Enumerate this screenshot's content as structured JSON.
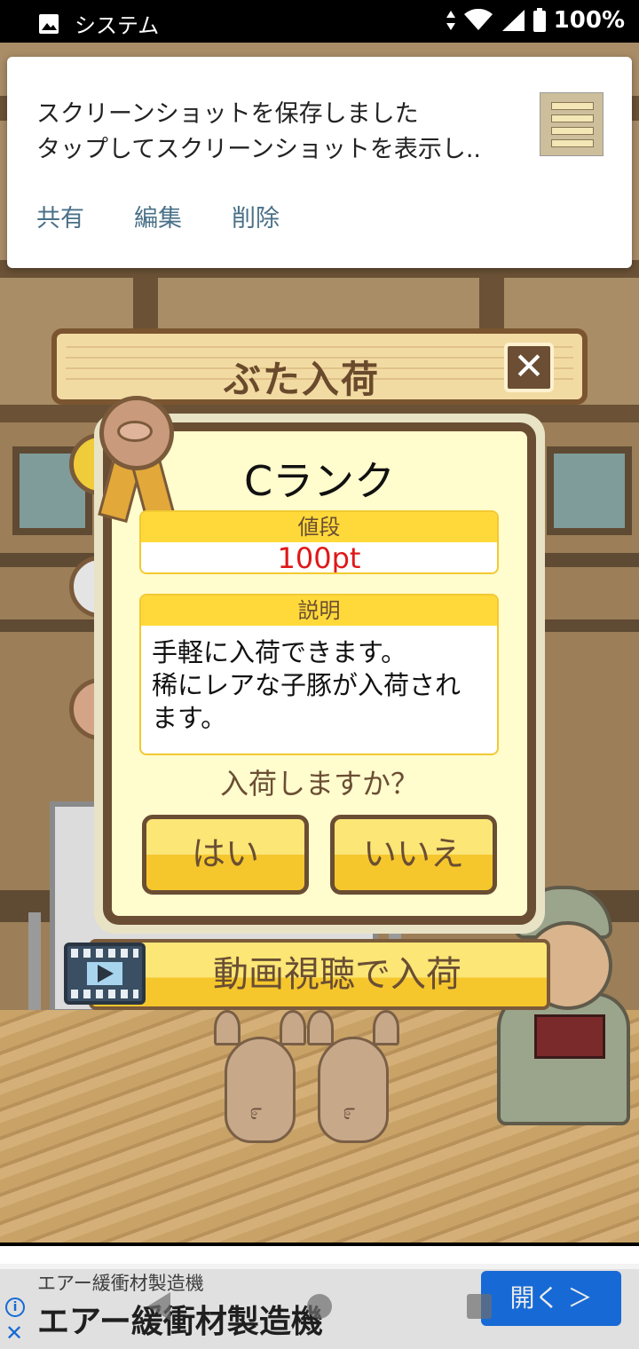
{
  "status_bar": {
    "app_title": "システム",
    "battery": "100%",
    "icons": [
      "image-icon",
      "data-arrows-icon",
      "wifi-icon",
      "signal-icon",
      "battery-icon"
    ]
  },
  "notification": {
    "line1": "スクリーンショットを保存しました",
    "line2": "タップしてスクリーンショットを表示し..",
    "actions": [
      "共有",
      "編集",
      "削除"
    ]
  },
  "dialog": {
    "title": "ぶた入荷",
    "close_symbol": "✕",
    "rank": "Cランク",
    "price_label": "値段",
    "price_value": "100pt",
    "description_label": "説明",
    "description_lines": [
      "手軽に入荷できます。",
      "稀にレアな子豚が入荷され",
      "ます。"
    ],
    "question": "入荷しますか？",
    "yes_label": "はい",
    "no_label": "いいえ",
    "video_label": "動画視聴で入荷"
  },
  "ad": {
    "small_text": "エアー緩衝材製造機",
    "big_text": "エアー緩衝材製造機",
    "button_label": "開く ＞",
    "info_symbol": "i",
    "close_symbol": "✕"
  },
  "colors": {
    "accent_yellow": "#ffd93a",
    "wood_dark": "#6a4e33",
    "price_red": "#e01818",
    "ad_blue": "#1a73e8"
  }
}
